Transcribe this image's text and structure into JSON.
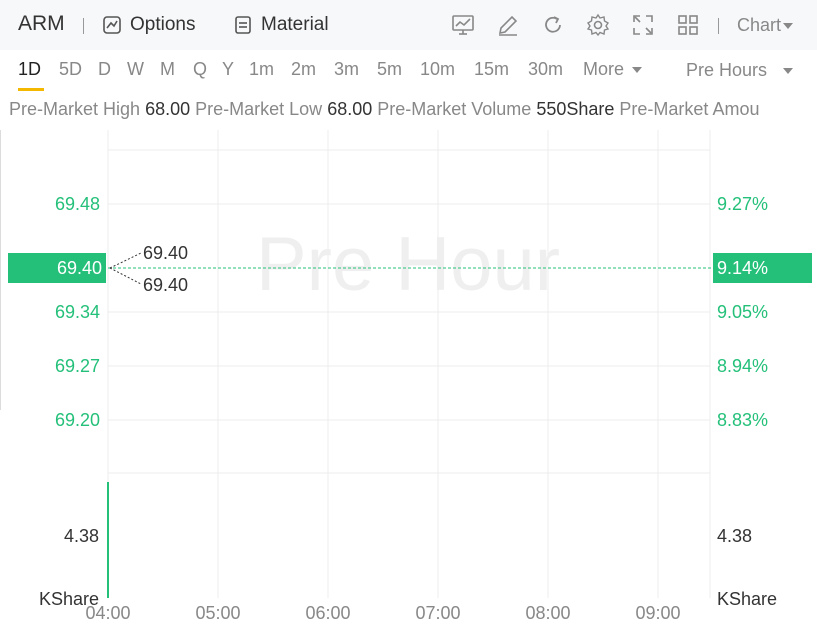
{
  "header": {
    "ticker": "ARM",
    "options_label": "Options",
    "material_label": "Material",
    "chart_select": "Chart"
  },
  "timeframes": [
    "1D",
    "5D",
    "D",
    "W",
    "M",
    "Q",
    "Y",
    "1m",
    "2m",
    "3m",
    "5m",
    "10m",
    "15m",
    "30m"
  ],
  "active_timeframe": "1D",
  "more_label": "More",
  "session_select": "Pre Hours",
  "stats": {
    "high_label": "Pre-Market High",
    "high_value": "68.00",
    "low_label": "Pre-Market Low",
    "low_value": "68.00",
    "volume_label": "Pre-Market Volume",
    "volume_value": "550Share",
    "amount_label": "Pre-Market Amou"
  },
  "watermark": "Pre Hour",
  "colors": {
    "accent": "#f5b800",
    "up": "#24c07a",
    "grid": "#ececec"
  },
  "chart_data": {
    "type": "line",
    "x_labels": [
      "04:00",
      "05:00",
      "06:00",
      "07:00",
      "08:00",
      "09:00"
    ],
    "price_ticks": [
      "69.48",
      "69.34",
      "69.27",
      "69.20"
    ],
    "percent_ticks": [
      "9.27%",
      "9.05%",
      "8.94%",
      "8.83%"
    ],
    "current_price": "69.40",
    "current_percent": "9.14%",
    "callouts": [
      "69.40",
      "69.40"
    ],
    "volume_tick": "4.38",
    "volume_unit": "KShare"
  }
}
